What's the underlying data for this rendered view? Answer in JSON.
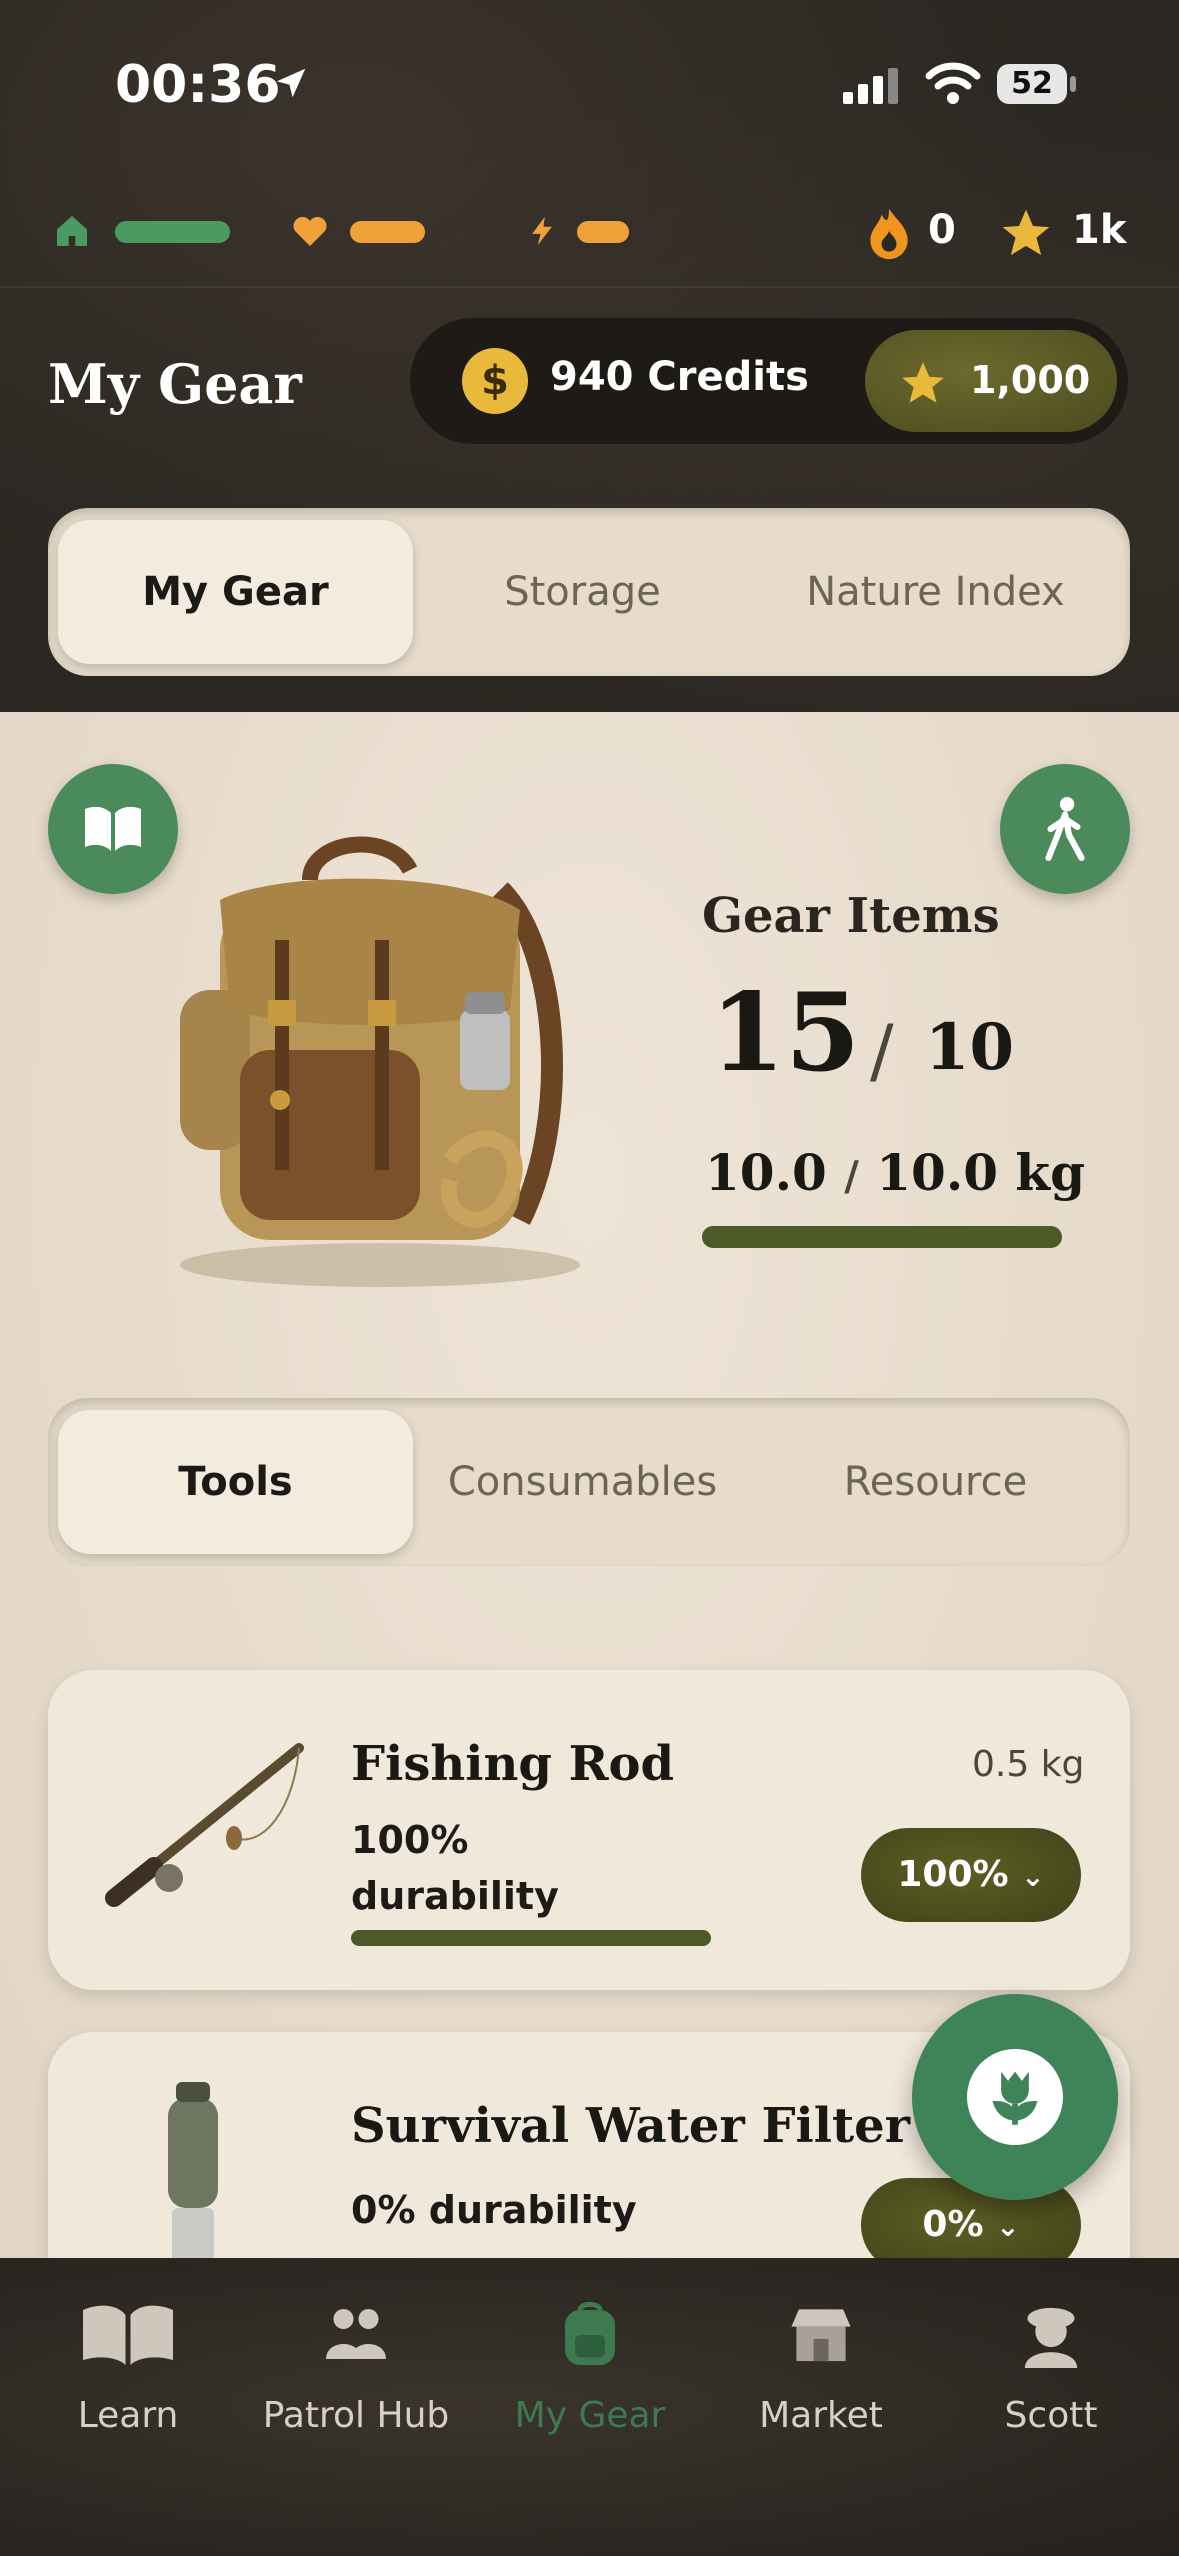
{
  "status": {
    "time": "00:36",
    "battery": "52"
  },
  "hud": {
    "flame_count": "0",
    "star_count": "1k",
    "colors": {
      "home": "#4a9a62",
      "heart": "#f0a13a",
      "energy": "#f0a13a"
    }
  },
  "header": {
    "title": "My Gear",
    "credits_label": "940 Credits",
    "coin_symbol": "$",
    "stars_value": "1,000"
  },
  "top_tabs": [
    {
      "label": "My Gear",
      "active": true
    },
    {
      "label": "Storage"
    },
    {
      "label": "Nature Index"
    }
  ],
  "summary": {
    "heading": "Gear Items",
    "count": "15",
    "capacity": "10",
    "slash": "/",
    "weight_current": "10.0",
    "weight_max": "10.0 kg",
    "weight_fraction": 1.0
  },
  "category_tabs": [
    {
      "label": "Tools",
      "active": true
    },
    {
      "label": "Consumables"
    },
    {
      "label": "Resource"
    }
  ],
  "items": [
    {
      "name": "Fishing Rod",
      "weight": "0.5 kg",
      "durability_pct": "100%",
      "durability_word": "durability",
      "durability_fraction": 1.0,
      "pill": "100%"
    },
    {
      "name": "Survival Water Filter",
      "durability_text": "0% durability",
      "durability_fraction": 0.0,
      "pill": "0%"
    }
  ],
  "nav": [
    {
      "label": "Learn",
      "icon": "book-icon"
    },
    {
      "label": "Patrol Hub",
      "icon": "people-icon"
    },
    {
      "label": "My Gear",
      "icon": "backpack-icon",
      "active": true
    },
    {
      "label": "Market",
      "icon": "market-icon"
    },
    {
      "label": "Scott",
      "icon": "avatar-icon"
    }
  ]
}
